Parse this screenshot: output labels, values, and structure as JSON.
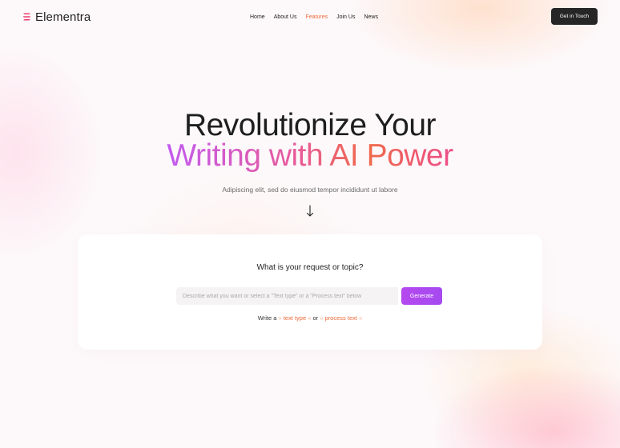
{
  "nav": {
    "logo_text": "Elementra",
    "menu": [
      {
        "label": "Home",
        "active": false
      },
      {
        "label": "About Us",
        "active": false
      },
      {
        "label": "Features",
        "active": true
      },
      {
        "label": "Join Us",
        "active": false
      },
      {
        "label": "News",
        "active": false
      }
    ],
    "cta_label": "Get in Touch"
  },
  "hero": {
    "line1": "Revolutionize Your",
    "line2": "Writing with AI Power",
    "subtitle": "Adipiscing elit, sed do eiusmod tempor incididunt ut labore"
  },
  "card": {
    "title": "What is your request or topic?",
    "input_placeholder": "Describe what you want or select a \"Text type\" or a \"Process text\" below",
    "generate_label": "Generate",
    "write_prefix": "Write a",
    "text_type_label": "text type",
    "or_label": "or",
    "process_text_label": "process text"
  },
  "colors": {
    "accent_orange": "#ef6a3a",
    "accent_purple": "#b548ef",
    "dark_button": "#262626"
  },
  "icons": {
    "logo": "elementra-logo-icon",
    "scroll": "arrow-down-icon"
  }
}
